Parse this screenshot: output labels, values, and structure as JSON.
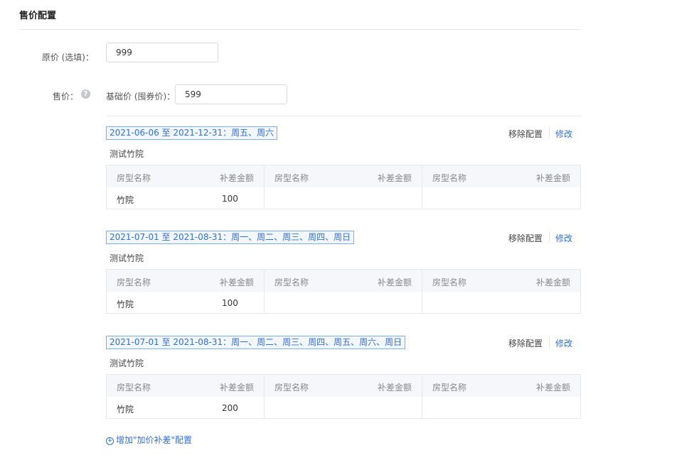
{
  "section": {
    "title": "售价配置"
  },
  "original_price": {
    "label": "原价 (选填)：",
    "value": "999"
  },
  "sale_price": {
    "label": "售价：",
    "help_icon": "question-circle",
    "base_label": "基础价 (囤券价)：",
    "base_value": "599"
  },
  "table_headers": {
    "room_name": "房型名称",
    "amount": "补差金额"
  },
  "configs": [
    {
      "date_range": "2021-06-06 至 2021-12-31：周五、周六",
      "remove_label": "移除配置",
      "edit_label": "修改",
      "hotel": "测试竹院",
      "rows": [
        {
          "room": "竹院",
          "amount": "100"
        }
      ]
    },
    {
      "date_range": "2021-07-01 至 2021-08-31：周一、周二、周三、周四、周日",
      "remove_label": "移除配置",
      "edit_label": "修改",
      "hotel": "测试竹院",
      "rows": [
        {
          "room": "竹院",
          "amount": "100"
        }
      ]
    },
    {
      "date_range": "2021-07-01 至 2021-08-31：周一、周二、周三、周四、周五、周六、周日",
      "remove_label": "移除配置",
      "edit_label": "修改",
      "hotel": "测试竹院",
      "rows": [
        {
          "room": "竹院",
          "amount": "200"
        }
      ]
    }
  ],
  "add_link": {
    "icon": "plus-circle",
    "label": "增加\"加价补差\"配置"
  },
  "colors": {
    "accent": "#2f6fd6",
    "tag_border": "#7aaef0",
    "table_header_bg": "#f5f7fa",
    "border": "#e8e8e8"
  }
}
